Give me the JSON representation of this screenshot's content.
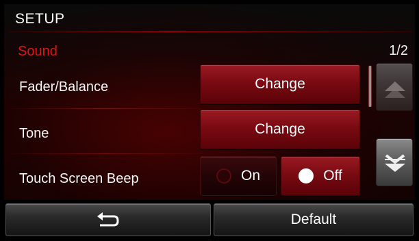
{
  "header": {
    "title": "SETUP"
  },
  "section": {
    "title": "Sound",
    "page_indicator": "1/2"
  },
  "rows": {
    "fader_balance": {
      "label": "Fader/Balance",
      "button": "Change"
    },
    "tone": {
      "label": "Tone",
      "button": "Change"
    },
    "touch_beep": {
      "label": "Touch Screen Beep",
      "options": {
        "on": "On",
        "off": "Off"
      },
      "selected": "Off"
    }
  },
  "scroll": {
    "up_icon": "chevron-up-icon",
    "down_icon": "double-chevron-down-icon"
  },
  "footer": {
    "back_icon": "back-arrow-icon",
    "default_label": "Default"
  },
  "colors": {
    "accent": "#e01515",
    "button_red": "#7a0a12"
  }
}
